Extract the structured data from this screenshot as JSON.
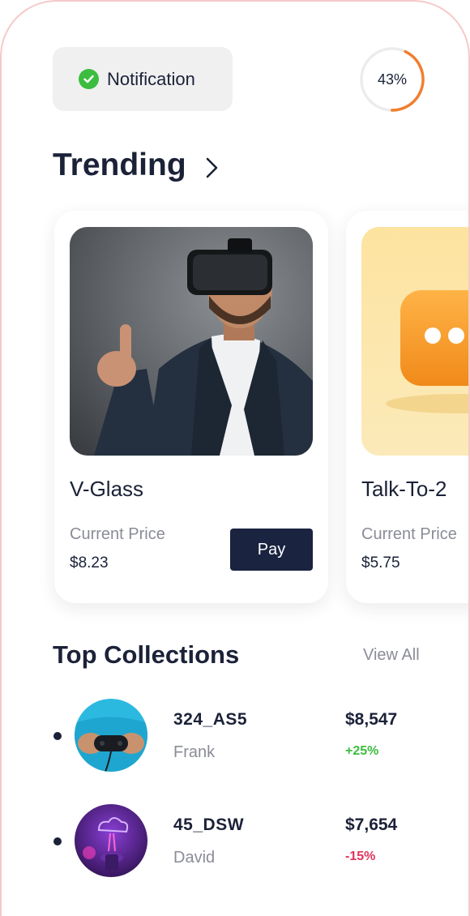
{
  "notification": {
    "label": "Notification",
    "icon": "check-circle-icon",
    "icon_color": "#3dbd3f"
  },
  "progress": {
    "label": "43%",
    "value": 0.43,
    "color": "#f07f2f"
  },
  "trending": {
    "title": "Trending",
    "arrow_icon": "chevron-right-icon",
    "cards": [
      {
        "name": "V-Glass",
        "price_label": "Current Price",
        "price": "$8.23",
        "pay_label": "Pay",
        "image": "vr-headset-man-photo"
      },
      {
        "name": "Talk-To-2",
        "price_label": "Current Price",
        "price": "$5.75",
        "image": "orange-chat-bubble-3d"
      }
    ]
  },
  "collections": {
    "title": "Top Collections",
    "view_all": "View All",
    "items": [
      {
        "name": "324_AS5",
        "owner": "Frank",
        "value": "$8,547",
        "change": "+25%",
        "change_color": "#3dbd3f",
        "image": "gamepad-blue-photo"
      },
      {
        "name": "45_DSW",
        "owner": "David",
        "value": "$7,654",
        "change": "-15%",
        "change_color": "#e0335a",
        "image": "neon-purple-photo"
      }
    ]
  },
  "colors": {
    "text": "#1b2238",
    "muted": "#8a8d96",
    "button": "#1a2340"
  }
}
